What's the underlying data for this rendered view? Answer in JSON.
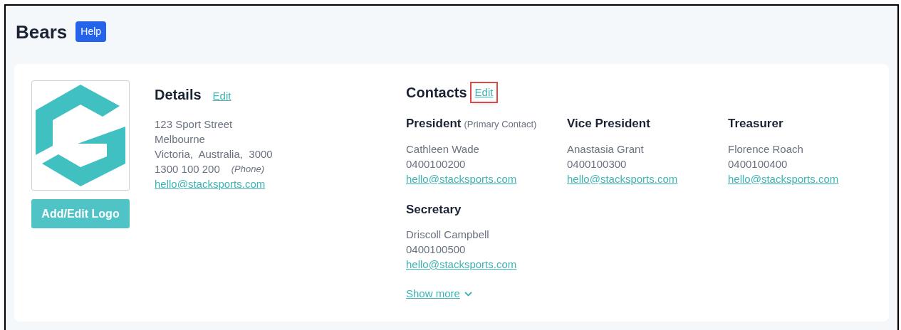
{
  "page": {
    "title": "Bears",
    "help_button": "Help"
  },
  "logo": {
    "button": "Add/Edit Logo"
  },
  "details": {
    "title": "Details",
    "edit_link": "Edit",
    "lines": [
      "123 Sport Street",
      "Melbourne",
      "Victoria,  Australia,  3000"
    ],
    "phone": "1300 100 200",
    "phone_label": "(Phone)",
    "email": "hello@stacksports.com"
  },
  "contacts": {
    "title": "Contacts",
    "edit_link": "Edit",
    "edit_highlighted": true,
    "items": [
      {
        "role": "President",
        "note": "(Primary Contact)",
        "name": "Cathleen Wade",
        "phone": "0400100200",
        "email": "hello@stacksports.com"
      },
      {
        "role": "Vice President",
        "name": "Anastasia Grant",
        "phone": "0400100300",
        "email": "hello@stacksports.com"
      },
      {
        "role": "Treasurer",
        "name": "Florence Roach",
        "phone": "0400100400",
        "email": "hello@stacksports.com"
      },
      {
        "role": "Secretary",
        "name": "Driscoll Campbell",
        "phone": "0400100500",
        "email": "hello@stacksports.com"
      }
    ],
    "show_more": "Show more"
  }
}
